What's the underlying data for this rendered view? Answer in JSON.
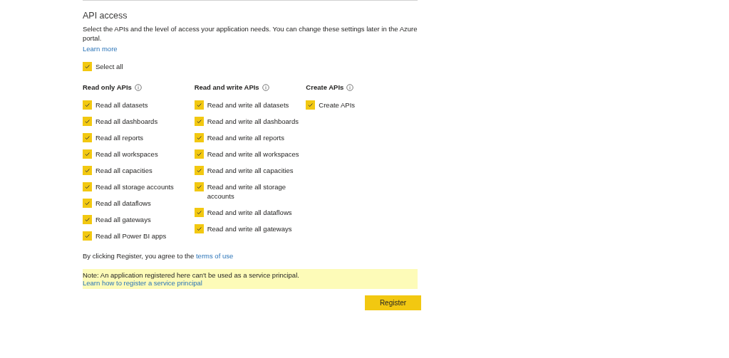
{
  "section": {
    "title": "API access",
    "description": "Select the APIs and the level of access your application needs. You can change these settings later in the Azure portal.",
    "learn_more": "Learn more"
  },
  "select_all": {
    "label": "Select all",
    "checked": true
  },
  "groups": [
    {
      "title": "Read only APIs",
      "items": [
        {
          "label": "Read all datasets",
          "checked": true
        },
        {
          "label": "Read all dashboards",
          "checked": true
        },
        {
          "label": "Read all reports",
          "checked": true
        },
        {
          "label": "Read all workspaces",
          "checked": true
        },
        {
          "label": "Read all capacities",
          "checked": true
        },
        {
          "label": "Read all storage accounts",
          "checked": true
        },
        {
          "label": "Read all dataflows",
          "checked": true
        },
        {
          "label": "Read all gateways",
          "checked": true
        },
        {
          "label": "Read all Power BI apps",
          "checked": true
        }
      ]
    },
    {
      "title": "Read and write APIs",
      "items": [
        {
          "label": "Read and write all datasets",
          "checked": true
        },
        {
          "label": "Read and write all dashboards",
          "checked": true
        },
        {
          "label": "Read and write all reports",
          "checked": true
        },
        {
          "label": "Read and write all workspaces",
          "checked": true
        },
        {
          "label": "Read and write all capacities",
          "checked": true
        },
        {
          "label": "Read and write all storage accounts",
          "checked": true
        },
        {
          "label": "Read and write all dataflows",
          "checked": true
        },
        {
          "label": "Read and write all gateways",
          "checked": true
        }
      ]
    },
    {
      "title": "Create APIs",
      "items": [
        {
          "label": "Create APIs",
          "checked": true
        }
      ]
    }
  ],
  "terms": {
    "text": "By clicking Register, you agree to the",
    "link": "terms of use"
  },
  "note": {
    "text": "Note: An application registered here can't be used as a service principal.",
    "link": "Learn how to register a service principal"
  },
  "register_button": "Register"
}
